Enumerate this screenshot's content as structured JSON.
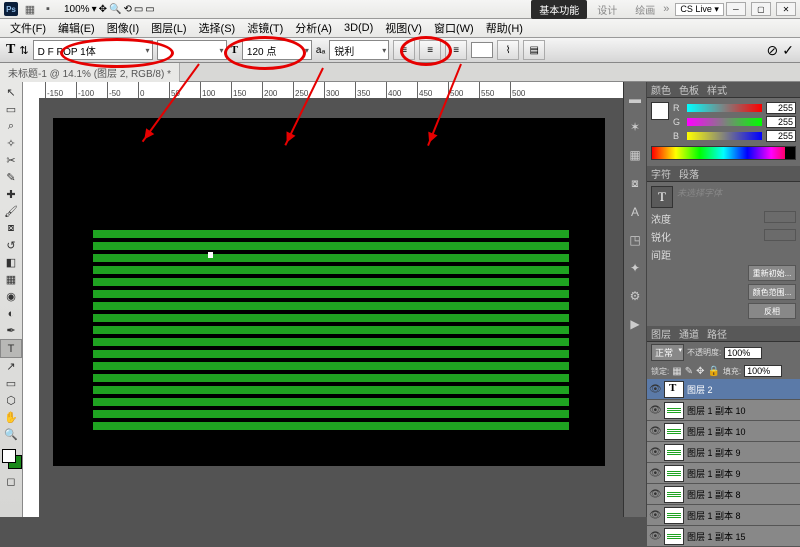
{
  "app": {
    "ps": "Ps",
    "zoom": "100%"
  },
  "titlepills": {
    "basic": "基本功能",
    "p2": "设计",
    "p3": "绘画",
    "cslive": "CS Live"
  },
  "menu": {
    "file": "文件(F)",
    "edit": "编辑(E)",
    "image": "图像(I)",
    "layer": "图层(L)",
    "select": "选择(S)",
    "filter": "滤镜(T)",
    "analysis": "分析(A)",
    "view3d": "3D(D)",
    "view": "视图(V)",
    "window": "窗口(W)",
    "help": "帮助(H)"
  },
  "opt": {
    "font": "D F POP 1体",
    "size": "120 点",
    "aa": "锐利"
  },
  "tab": {
    "doc": "未标题-1 @ 14.1% (图层 2, RGB/8) *"
  },
  "ruler": [
    "-150",
    "-100",
    "-50",
    "0",
    "50",
    "100",
    "150",
    "200",
    "250",
    "300",
    "350",
    "400",
    "450",
    "500",
    "550",
    "500"
  ],
  "color_panel": {
    "tab1": "颜色",
    "tab2": "色板",
    "tab3": "样式",
    "r": "255",
    "g": "255",
    "b": "255"
  },
  "char_panel": {
    "tab1": "字符",
    "tab2": "段落",
    "ph": "未选择字体",
    "l1": "浓度",
    "l2": "锐化",
    "l3": "间距",
    "b1": "重新初始...",
    "b2": "颜色范围...",
    "b3": "反相"
  },
  "layers": {
    "tab1": "图层",
    "tab2": "通道",
    "tab3": "路径",
    "mode": "正常",
    "opacity_lbl": "不透明度:",
    "opacity": "100%",
    "lock": "锁定:",
    "fill_lbl": "填充:",
    "fill": "100%",
    "items": [
      {
        "name": "图层 2",
        "type": "text",
        "active": true
      },
      {
        "name": "图层 1 副本 10",
        "type": "green"
      },
      {
        "name": "图层 1 副本 10",
        "type": "green"
      },
      {
        "name": "图层 1 副本 9",
        "type": "green"
      },
      {
        "name": "图层 1 副本 9",
        "type": "green"
      },
      {
        "name": "图层 1 副本 8",
        "type": "green"
      },
      {
        "name": "图层 1 副本 8",
        "type": "green"
      },
      {
        "name": "图层 1 副本 15",
        "type": "green"
      }
    ]
  }
}
